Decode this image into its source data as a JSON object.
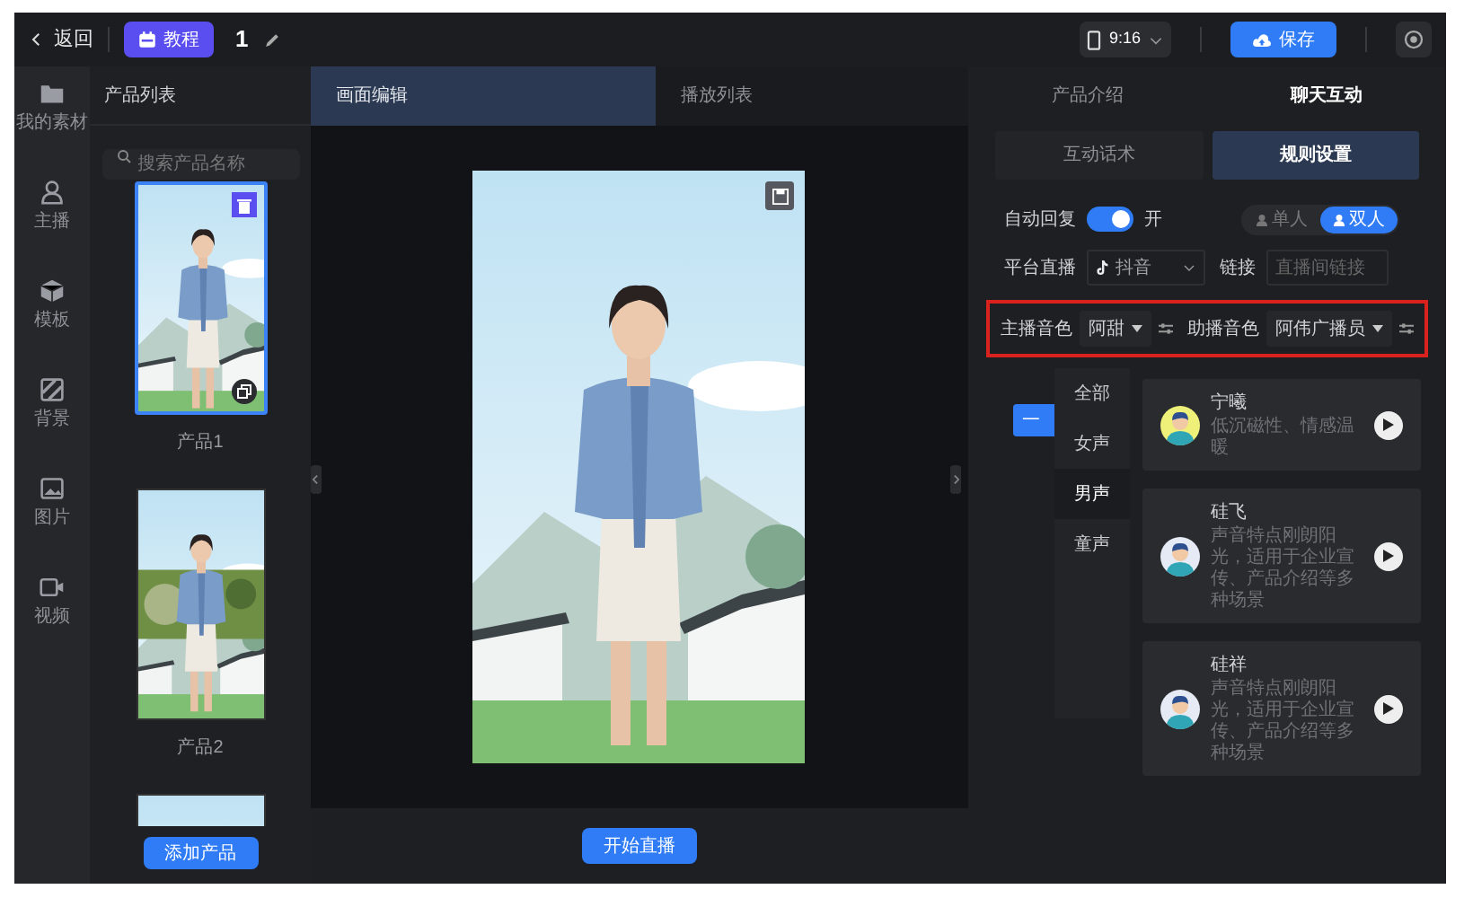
{
  "top_bar": {
    "back": "返回",
    "tutorial_button": "教程",
    "project_name": "1",
    "aspect_ratio": "9:16",
    "save_button": "保存"
  },
  "rail": [
    {
      "label": "我的素材"
    },
    {
      "label": "主播"
    },
    {
      "label": "模板"
    },
    {
      "label": "背景"
    },
    {
      "label": "图片"
    },
    {
      "label": "视频"
    }
  ],
  "product_panel": {
    "title": "产品列表",
    "search_placeholder": "搜索产品名称",
    "products": [
      {
        "label": "产品1",
        "selected": true
      },
      {
        "label": "产品2",
        "selected": false
      },
      {
        "selected": false
      }
    ],
    "add_button": "添加产品"
  },
  "editor": {
    "tabs": [
      {
        "label": "画面编辑",
        "selected": true
      },
      {
        "label": "播放列表",
        "selected": false
      }
    ],
    "start_button": "开始直播"
  },
  "settings": {
    "tabs": [
      {
        "label": "产品介绍",
        "selected": false
      },
      {
        "label": "聊天互动",
        "selected": true
      }
    ],
    "subtabs": [
      {
        "label": "互动话术",
        "selected": false
      },
      {
        "label": "规则设置",
        "selected": true
      }
    ],
    "auto_reply": {
      "label": "自动回复",
      "on": true,
      "state_text": "开"
    },
    "mode": [
      {
        "label": "单人",
        "selected": false
      },
      {
        "label": "双人",
        "selected": true
      }
    ],
    "platform": {
      "label": "平台直播",
      "value": "抖音"
    },
    "link": {
      "label": "链接",
      "placeholder": "直播间链接"
    },
    "host_voice": {
      "label": "主播音色",
      "value": "阿甜"
    },
    "assistant_voice": {
      "label": "助播音色",
      "value": "阿伟广播员"
    },
    "partial_button": "一",
    "voice_filter": [
      {
        "label": "全部",
        "selected": false
      },
      {
        "label": "女声",
        "selected": false
      },
      {
        "label": "男声",
        "selected": true
      },
      {
        "label": "童声",
        "selected": false
      }
    ],
    "voices": [
      {
        "name": "宁曦",
        "description": "低沉磁性、情感温暖",
        "color": "#eef07a"
      },
      {
        "name": "硅飞",
        "description": "声音特点刚朗阳光，适用于企业宣传、产品介绍等多种场景",
        "color": "#e6eaf4"
      },
      {
        "name": "硅祥",
        "description": "声音特点刚朗阳光，适用于企业宣传、产品介绍等多种场景",
        "color": "#e6eaf4"
      }
    ]
  }
}
